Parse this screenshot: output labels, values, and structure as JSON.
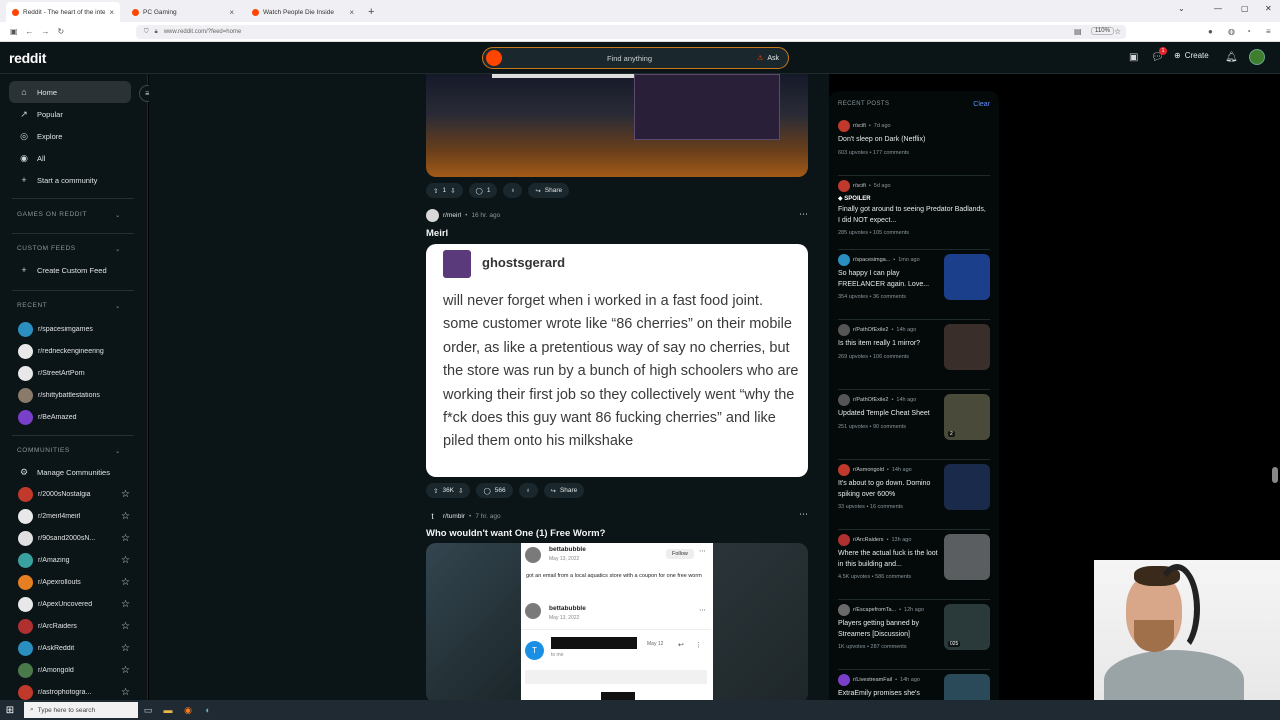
{
  "browser": {
    "tabs": [
      {
        "title": "Reddit - The heart of the intern",
        "color": "#ff4500",
        "active": true
      },
      {
        "title": "PC Gaming",
        "color": "#ff4500",
        "active": false
      },
      {
        "title": "Watch People Die Inside",
        "color": "#ff4500",
        "active": false
      }
    ],
    "url": "www.reddit.com/?feed=home",
    "zoom": "110%"
  },
  "header": {
    "logo": "reddit",
    "search_placeholder": "Find anything",
    "ask_label": "Ask",
    "create_label": "Create",
    "notification_count": "1"
  },
  "left_nav": {
    "items": [
      {
        "label": "Home",
        "icon": "home-icon"
      },
      {
        "label": "Popular",
        "icon": "popular-icon"
      },
      {
        "label": "Explore",
        "icon": "explore-icon"
      },
      {
        "label": "All",
        "icon": "all-icon"
      },
      {
        "label": "Start a community",
        "icon": "plus-icon"
      }
    ],
    "games_header": "GAMES ON REDDIT",
    "custom_feeds_header": "CUSTOM FEEDS",
    "create_custom_feed": "Create Custom Feed",
    "recent_header": "RECENT",
    "recent": [
      {
        "name": "r/spacesimgames",
        "color": "#2a8fbf"
      },
      {
        "name": "r/redneckengineering",
        "color": "#e8e8e8"
      },
      {
        "name": "r/StreetArtPorn",
        "color": "#e8e8e8"
      },
      {
        "name": "r/shittybattlestations",
        "color": "#8a7a6a"
      },
      {
        "name": "r/BeAmazed",
        "color": "#7a3fc9"
      }
    ],
    "communities_header": "COMMUNITIES",
    "manage_communities": "Manage Communities",
    "communities": [
      {
        "name": "r/2000sNostalgia",
        "color": "#c0392b"
      },
      {
        "name": "r/2meirl4meirl",
        "color": "#e8e8e8"
      },
      {
        "name": "r/90sand2000sN...",
        "color": "#e0e0e0"
      },
      {
        "name": "r/Amazing",
        "color": "#3aa0a0"
      },
      {
        "name": "r/Apexrollouts",
        "color": "#e67e22"
      },
      {
        "name": "r/ApexUncovered",
        "color": "#e8e8e8"
      },
      {
        "name": "r/ArcRaiders",
        "color": "#b03030"
      },
      {
        "name": "r/AskReddit",
        "color": "#2a8fbf"
      },
      {
        "name": "r/Amongold",
        "color": "#4a7a4a"
      },
      {
        "name": "r/astrophotogra...",
        "color": "#c0392b"
      }
    ]
  },
  "feed": {
    "post1_actions": {
      "votes": "1",
      "comments": "1",
      "share": "Share"
    },
    "post2": {
      "subreddit": "r/meirl",
      "time": "16 hr. ago",
      "title": "Meirl",
      "tweet_user": "ghostsgerard",
      "tweet_text": "will never forget when i worked in a fast food joint. some customer wrote like “86 cherries” on their mobile order, as like a pretentious way of say no cherries, but the store was run by a bunch of high schoolers who are working their first job so they collectively went “why the f*ck does this guy want 86 fucking cherries” and like piled them onto his milkshake",
      "votes": "36K",
      "comments": "566",
      "share": "Share"
    },
    "post3": {
      "subreddit": "r/tumblr",
      "time": "7 hr. ago",
      "title": "Who wouldn't want One (1) Free Worm?",
      "user1": "bettabubble",
      "date1": "May 13, 2022",
      "follow": "Follow",
      "text1": "got an email from a local aquatics store with a coupon for one free worm",
      "user2": "bettabubble",
      "date2": "May 13, 2022",
      "email_initial": "T",
      "email_date": "May 12",
      "email_to": "to me"
    }
  },
  "recent_posts": {
    "header": "RECENT POSTS",
    "clear": "Clear",
    "items": [
      {
        "sub": "r/scifi",
        "time": "7d ago",
        "title": "Don't sleep on Dark (Netflix)",
        "upvotes": "603 upvotes",
        "comments": "177 comments",
        "thumb": false,
        "av": "#c0392b"
      },
      {
        "sub": "r/scifi",
        "time": "5d ago",
        "spoiler": "SPOILER",
        "title": "Finally got around to seeing Predator Badlands, I did NOT expect...",
        "upvotes": "285 upvotes",
        "comments": "105 comments",
        "thumb": false,
        "av": "#c0392b"
      },
      {
        "sub": "r/spacesimga...",
        "time": "1mo ago",
        "title": "So happy I can play FREELANCER again. Love...",
        "upvotes": "354 upvotes",
        "comments": "36 comments",
        "thumb": true,
        "thumbcolor": "#1b3f8a",
        "av": "#2a8fbf"
      },
      {
        "sub": "r/PathOfExile2",
        "time": "14h ago",
        "title": "Is this item really 1 mirror?",
        "upvotes": "269 upvotes",
        "comments": "106 comments",
        "thumb": true,
        "thumbcolor": "#3a2e2a",
        "av": "#555"
      },
      {
        "sub": "r/PathOfExile2",
        "time": "14h ago",
        "title": "Updated Temple Cheat Sheet",
        "upvotes": "251 upvotes",
        "comments": "90 comments",
        "thumb": true,
        "thumbcolor": "#4a4a3a",
        "av": "#555",
        "badge": "2"
      },
      {
        "sub": "r/Asmongold",
        "time": "14h ago",
        "title": "It's about to go down. Domino spiking over 600%",
        "upvotes": "33 upvotes",
        "comments": "16 comments",
        "thumb": true,
        "thumbcolor": "#1a2a4a",
        "av": "#c0392b"
      },
      {
        "sub": "r/ArcRaiders",
        "time": "13h ago",
        "title": "Where the actual fuck is the loot in this building and...",
        "upvotes": "4.5K upvotes",
        "comments": "586 comments",
        "thumb": true,
        "thumbcolor": "#5a5e60",
        "av": "#b03030"
      },
      {
        "sub": "r/EscapefromTa...",
        "time": "12h ago",
        "title": "Players getting banned by Streamers [Discussion]",
        "upvotes": "1K upvotes",
        "comments": "287 comments",
        "thumb": true,
        "thumbcolor": "#2a3a3a",
        "av": "#6a6a6a",
        "badge": "025"
      },
      {
        "sub": "r/LivestreamFail",
        "time": "14h ago",
        "title": "ExtraEmily promises she's",
        "upvotes": "",
        "comments": "",
        "thumb": true,
        "thumbcolor": "#2a4a5a",
        "av": "#7a3fc9"
      }
    ]
  },
  "taskbar": {
    "search_placeholder": "Type here to search"
  }
}
